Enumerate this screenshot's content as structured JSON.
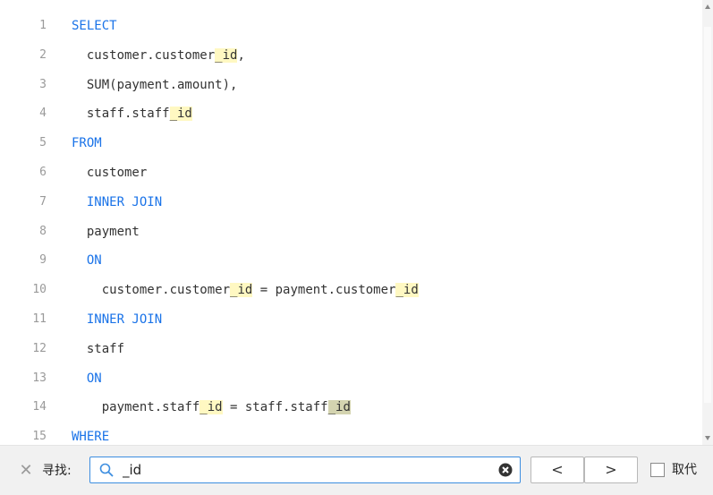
{
  "editor": {
    "lines": [
      {
        "num": "1",
        "segments": [
          {
            "t": "SELECT",
            "c": "kw"
          }
        ]
      },
      {
        "num": "2",
        "segments": [
          {
            "t": "  customer.customer"
          },
          {
            "t": "_id",
            "c": "hl"
          },
          {
            "t": ","
          }
        ]
      },
      {
        "num": "3",
        "segments": [
          {
            "t": "  SUM(payment.amount),"
          }
        ]
      },
      {
        "num": "4",
        "segments": [
          {
            "t": "  staff.staff"
          },
          {
            "t": "_id",
            "c": "hl"
          }
        ]
      },
      {
        "num": "5",
        "segments": [
          {
            "t": "FROM",
            "c": "kw"
          }
        ]
      },
      {
        "num": "6",
        "segments": [
          {
            "t": "  customer"
          }
        ]
      },
      {
        "num": "7",
        "segments": [
          {
            "t": "  "
          },
          {
            "t": "INNER JOIN",
            "c": "kw"
          }
        ]
      },
      {
        "num": "8",
        "segments": [
          {
            "t": "  payment"
          }
        ]
      },
      {
        "num": "9",
        "segments": [
          {
            "t": "  "
          },
          {
            "t": "ON",
            "c": "kw"
          }
        ]
      },
      {
        "num": "10",
        "segments": [
          {
            "t": "    customer.customer"
          },
          {
            "t": "_id",
            "c": "hl"
          },
          {
            "t": " = payment.customer"
          },
          {
            "t": "_id",
            "c": "hl"
          }
        ]
      },
      {
        "num": "11",
        "segments": [
          {
            "t": "  "
          },
          {
            "t": "INNER JOIN",
            "c": "kw"
          }
        ]
      },
      {
        "num": "12",
        "segments": [
          {
            "t": "  staff"
          }
        ]
      },
      {
        "num": "13",
        "segments": [
          {
            "t": "  "
          },
          {
            "t": "ON",
            "c": "kw"
          }
        ]
      },
      {
        "num": "14",
        "segments": [
          {
            "t": "    payment.staff"
          },
          {
            "t": "_id",
            "c": "hl"
          },
          {
            "t": " = staff.staff"
          },
          {
            "t": "_id",
            "c": "hl-cur"
          }
        ]
      },
      {
        "num": "15",
        "segments": [
          {
            "t": "WHERE",
            "c": "kw"
          }
        ]
      }
    ]
  },
  "findbar": {
    "label": "寻找:",
    "query": "_id",
    "prev_label": "<",
    "next_label": ">",
    "replace_label": "取代",
    "replace_checked": false
  },
  "icons": {
    "close": "close-icon",
    "search": "search-icon",
    "clear": "clear-icon"
  },
  "colors": {
    "keyword": "#1a73e8",
    "match_highlight": "#fff8c2",
    "current_match": "#d4d4b0",
    "search_border": "#3d8ee0"
  }
}
